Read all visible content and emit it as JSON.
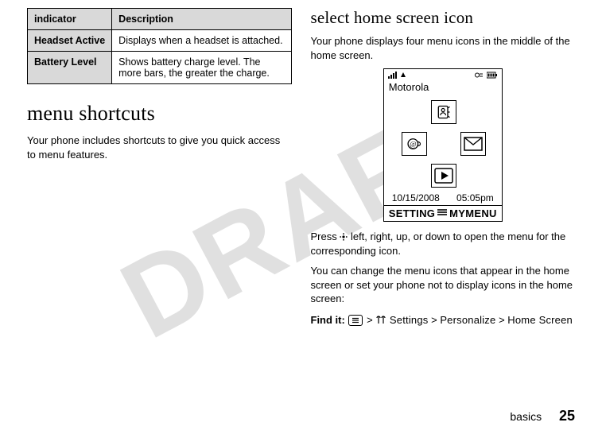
{
  "watermark": "DRAFT",
  "left": {
    "table": {
      "header_indicator": "indicator",
      "header_description": "Description",
      "rows": [
        {
          "indicator": "Headset Active",
          "description": "Displays when a headset is attached."
        },
        {
          "indicator": "Battery Level",
          "description": "Shows battery charge level. The more bars, the greater the charge."
        }
      ]
    },
    "heading": "menu shortcuts",
    "body": "Your phone includes shortcuts to give you quick access to menu features."
  },
  "right": {
    "heading": "select home screen icon",
    "intro": "Your phone displays four menu icons in the middle of the home screen.",
    "phone": {
      "brand": "Motorola",
      "date": "10/15/2008",
      "time": "05:05pm",
      "softkey_left": "SETTING",
      "softkey_right": "MYMENU"
    },
    "press_line_a": "Press ",
    "press_line_b": " left, right, up, or down to open the menu for the corresponding icon.",
    "change_line": "You can change the menu icons that appear in the home screen or set your phone not to display icons in the home screen:",
    "findit_label": "Find it:",
    "findit_path_a": "Settings",
    "findit_path_b": "Personalize",
    "findit_path_c": "Home Screen"
  },
  "footer": {
    "section": "basics",
    "page": "25"
  }
}
